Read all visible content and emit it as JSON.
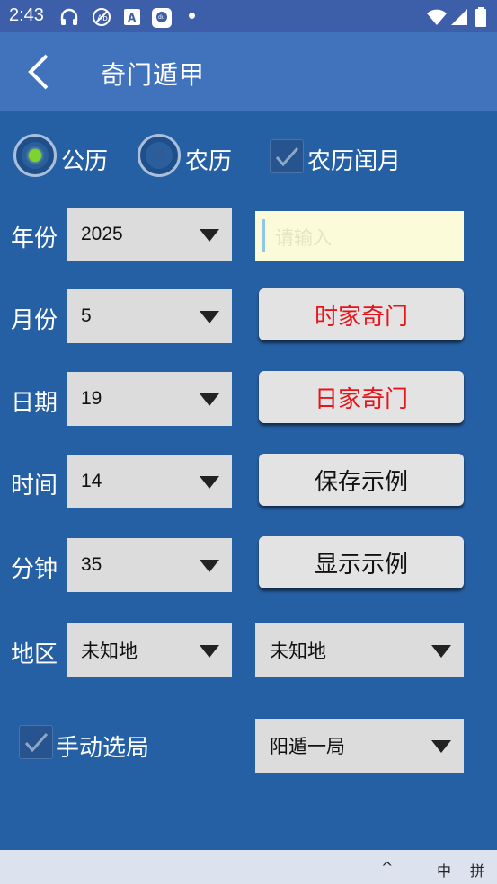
{
  "status_bar": {
    "time": "2:43",
    "icons": [
      "headphones-icon",
      "no-accessibility-icon",
      "a-notification-icon",
      "du-app-icon",
      "wifi-icon",
      "signal-icon",
      "battery-icon"
    ]
  },
  "app_bar": {
    "title": "奇门遁甲",
    "back_icon": "chevron-left-icon"
  },
  "calendar_options": {
    "gregorian_label": "公历",
    "gregorian_selected": true,
    "lunar_label": "农历",
    "lunar_selected": false,
    "leap_month_label": "农历闰月",
    "leap_month_checked": true
  },
  "form": {
    "year_label": "年份",
    "year_value": "2025",
    "month_label": "月份",
    "month_value": "5",
    "day_label": "日期",
    "day_value": "19",
    "hour_label": "时间",
    "hour_value": "14",
    "minute_label": "分钟",
    "minute_value": "35",
    "region_label": "地区",
    "region_value": "未知地",
    "region_secondary_value": "未知地",
    "text_input_placeholder": "请输入",
    "manual_label": "手动选局",
    "manual_checked": true,
    "ju_value": "阳遁一局"
  },
  "buttons": {
    "hour_qimen": "时家奇门",
    "day_qimen": "日家奇门",
    "save_example": "保存示例",
    "show_example": "显示示例"
  },
  "colors": {
    "background": "#2660a4",
    "app_bar": "#4173bd",
    "status_bar": "#3d5ea8",
    "accent_red": "#e8141b",
    "radio_selected": "#7ed32f"
  },
  "keyboard_bar": {
    "chevron": "^",
    "lang": "中",
    "mode": "拼"
  }
}
